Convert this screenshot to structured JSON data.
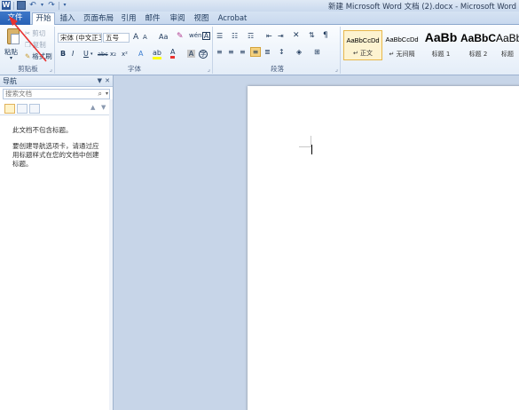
{
  "titlebar": {
    "app_icon": "W",
    "title": "新建 Microsoft Word 文档 (2).docx - Microsoft Word"
  },
  "tabs": [
    {
      "label": "文件"
    },
    {
      "label": "开始"
    },
    {
      "label": "插入"
    },
    {
      "label": "页面布局"
    },
    {
      "label": "引用"
    },
    {
      "label": "邮件"
    },
    {
      "label": "审阅"
    },
    {
      "label": "视图"
    },
    {
      "label": "Acrobat"
    }
  ],
  "ribbon": {
    "clipboard": {
      "paste": "粘贴",
      "cut": "剪切",
      "copy": "复制",
      "format_painter": "格式刷",
      "label": "剪贴板"
    },
    "font": {
      "font_name": "宋体 (中文正3",
      "font_size": "五号",
      "label": "字体",
      "grow": "A",
      "shrink": "A",
      "case": "Aa",
      "wen": "wén",
      "bold": "B",
      "italic": "I",
      "underline": "U",
      "strike": "abc",
      "sub": "x₂",
      "sup": "x²",
      "font_color": "A",
      "char_border": "A",
      "circle": "字"
    },
    "paragraph": {
      "label": "段落"
    },
    "styles": {
      "items": [
        {
          "sample": "AaBbCcDd",
          "name": "↵ 正文"
        },
        {
          "sample": "AaBbCcDd",
          "name": "↵ 无间隔"
        },
        {
          "sample": "AaBb",
          "name": "标题 1"
        },
        {
          "sample": "AaBbC",
          "name": "标题 2"
        },
        {
          "sample": "AaBb",
          "name": "标题"
        }
      ]
    }
  },
  "navpane": {
    "title": "导航",
    "search_placeholder": "搜索文档",
    "msg1": "此文档不包含标题。",
    "msg2": "要创建导航选项卡，请通过应用标题样式在您的文档中创建标题。"
  },
  "colors": {
    "file_tab": "#2660b5",
    "annotation_arrow": "#e8312f",
    "selected_style": "#fdf3d0"
  }
}
